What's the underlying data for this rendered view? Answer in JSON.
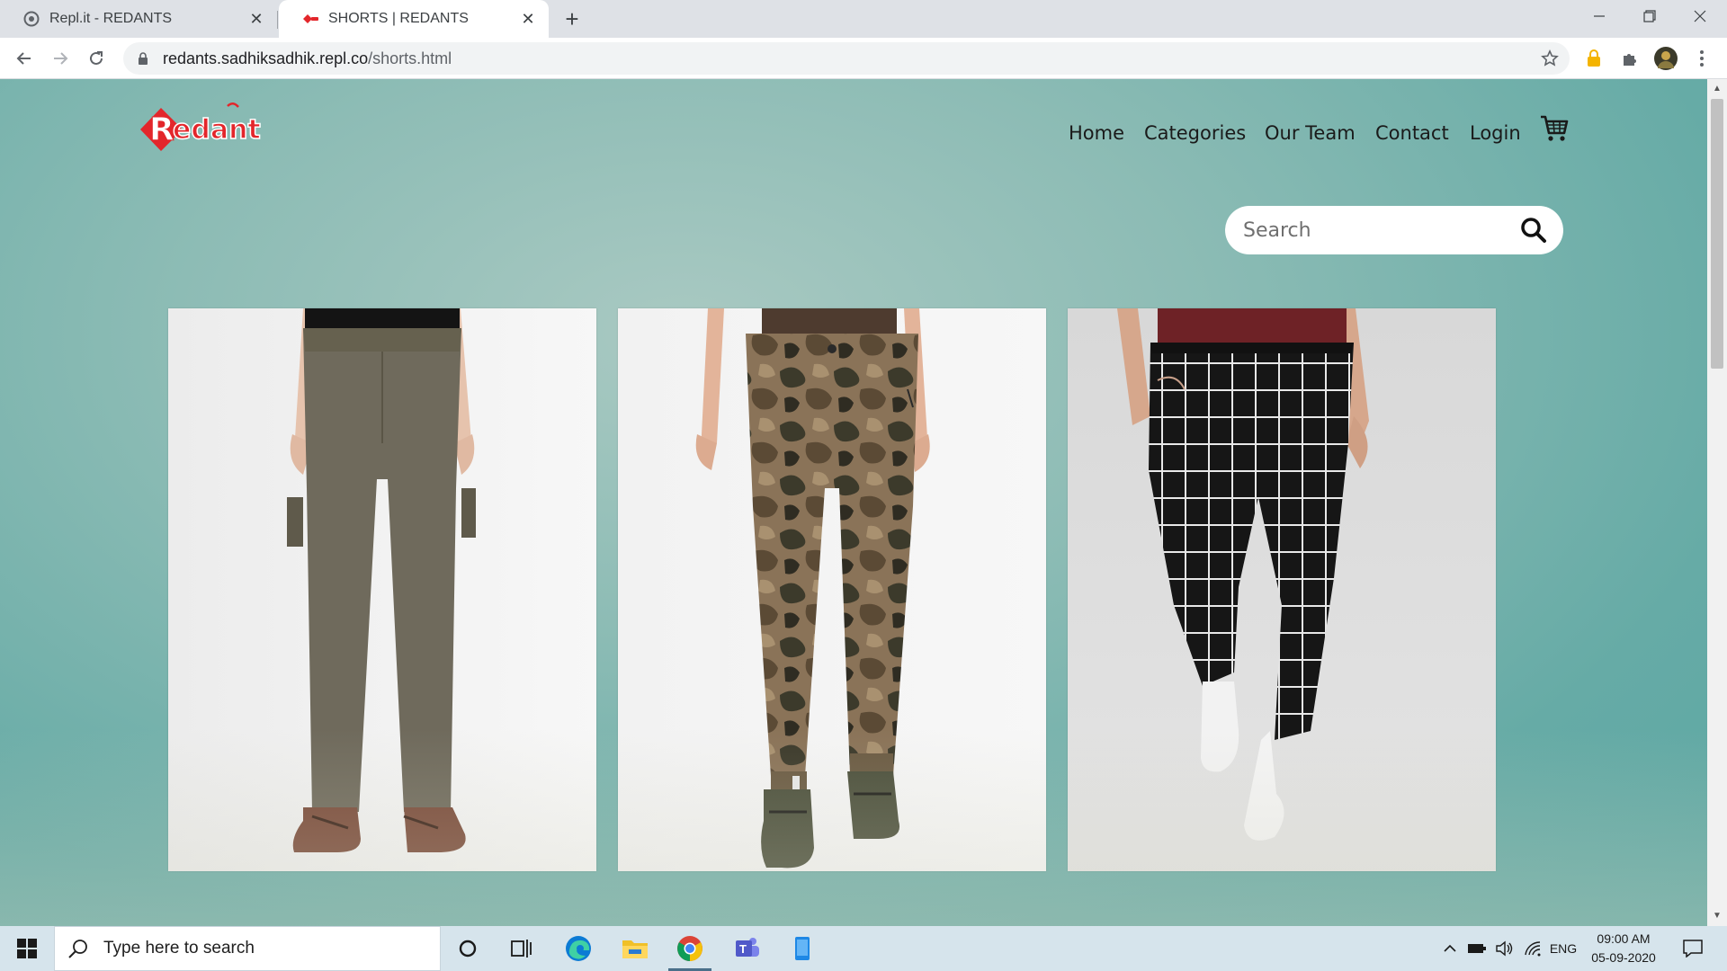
{
  "browser": {
    "tabs": [
      {
        "title": "Repl.it - REDANTS",
        "favicon": "replit-icon",
        "active": false
      },
      {
        "title": "SHORTS | REDANTS",
        "favicon": "redant-icon",
        "active": true
      }
    ],
    "url_host": "redants.sadhiksadhik.repl.co",
    "url_path": "/shorts.html"
  },
  "site": {
    "logo_text": "Redant",
    "nav": [
      "Home",
      "Categories",
      "Our Team",
      "Contact",
      "Login"
    ],
    "cart_icon": "cart-icon",
    "search_placeholder": "Search",
    "products": [
      {
        "description": "olive cargo trousers",
        "color": "#6f6a5c"
      },
      {
        "description": "camouflage cargo trousers",
        "color": "#6b5b43"
      },
      {
        "description": "black windowpane check trousers",
        "color": "#1b1b1b"
      }
    ]
  },
  "taskbar": {
    "search_placeholder": "Type here to search",
    "language": "ENG",
    "time": "09:00 AM",
    "date": "05-09-2020"
  },
  "colors": {
    "brand_red": "#e3262b",
    "page_teal": "#8dbcb5"
  }
}
